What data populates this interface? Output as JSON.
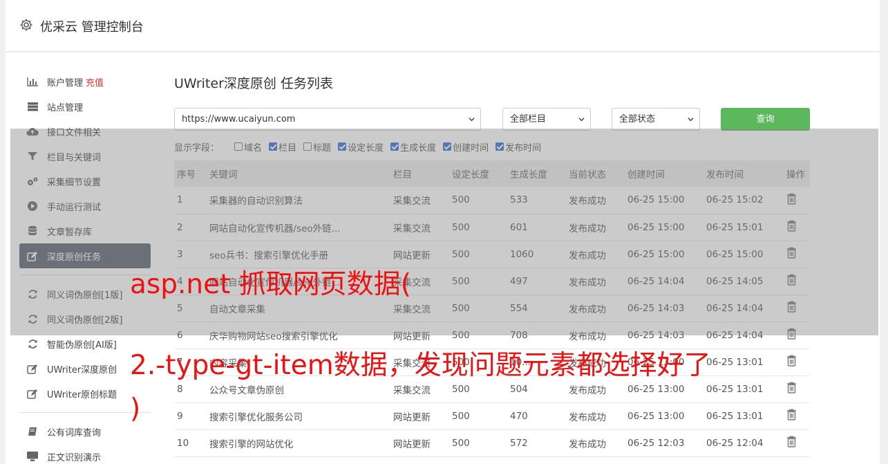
{
  "header": {
    "title": "优采云 管理控制台",
    "icon": "gear-icon"
  },
  "sidebar": {
    "groups": [
      [
        {
          "label": "账户管理",
          "extra": "充值",
          "icon": "bar-chart-icon"
        },
        {
          "label": "站点管理",
          "icon": "server-icon"
        },
        {
          "label": "接口文件相关",
          "icon": "cloud-upload-icon"
        },
        {
          "label": "栏目与关键词",
          "icon": "filter-icon"
        },
        {
          "label": "采集细节设置",
          "icon": "gears-icon"
        },
        {
          "label": "手动运行测试",
          "icon": "play-circle-icon"
        },
        {
          "label": "文章暂存库",
          "icon": "database-icon"
        },
        {
          "label": "深度原创任务",
          "icon": "edit-icon",
          "active": true
        }
      ],
      [
        {
          "label": "同义词伪原创[1版]",
          "icon": "refresh-icon"
        },
        {
          "label": "同义词伪原创[2版]",
          "icon": "refresh-icon"
        },
        {
          "label": "智能伪原创[AI版]",
          "icon": "refresh-icon"
        },
        {
          "label": "UWriter深度原创",
          "icon": "edit-icon"
        },
        {
          "label": "UWriter原创标题",
          "icon": "edit-icon"
        }
      ],
      [
        {
          "label": "公有词库查询",
          "icon": "book-icon"
        },
        {
          "label": "正文识别演示",
          "icon": "monitor-icon"
        }
      ]
    ]
  },
  "main": {
    "title": "UWriter深度原创 任务列表",
    "site_select": "https://www.ucaiyun.com",
    "column_select": "全部栏目",
    "status_select": "全部状态",
    "query_label": "查询",
    "fields_label": "显示字段：",
    "fields": [
      {
        "label": "域名",
        "checked": false
      },
      {
        "label": "栏目",
        "checked": true
      },
      {
        "label": "标题",
        "checked": false
      },
      {
        "label": "设定长度",
        "checked": true
      },
      {
        "label": "生成长度",
        "checked": true
      },
      {
        "label": "创建时间",
        "checked": true
      },
      {
        "label": "发布时间",
        "checked": true
      }
    ],
    "columns": [
      "序号",
      "关键词",
      "栏目",
      "设定长度",
      "生成长度",
      "当前状态",
      "创建时间",
      "发布时间",
      "操作"
    ],
    "rows": [
      [
        "1",
        "采集器的自动识别算法",
        "采集交流",
        "500",
        "533",
        "发布成功",
        "06-25 15:00",
        "06-25 15:02"
      ],
      [
        "2",
        "网站自动化宣传机器/seo外链...",
        "采集交流",
        "500",
        "601",
        "发布成功",
        "06-25 15:00",
        "06-25 15:01"
      ],
      [
        "3",
        "seo兵书：搜索引擎优化手册",
        "网站更新",
        "500",
        "1060",
        "发布成功",
        "06-25 15:00",
        "06-25 15:00"
      ],
      [
        "4",
        "网站自动化宣传机器/seo外链...",
        "采集交流",
        "500",
        "497",
        "发布成功",
        "06-25 14:04",
        "06-25 14:05"
      ],
      [
        "5",
        "自动文章采集",
        "采集交流",
        "500",
        "554",
        "发布成功",
        "06-25 14:03",
        "06-25 14:04"
      ],
      [
        "6",
        "庆华购物网站seo搜索引擎优化",
        "网站更新",
        "500",
        "708",
        "发布成功",
        "06-25 14:03",
        "06-25 14:04"
      ],
      [
        "7",
        "内容采集",
        "采集交流",
        "500",
        "10...",
        "发布成功",
        "06-25 13:00",
        "06-25 13:01"
      ],
      [
        "8",
        "公众号文章伪原创",
        "采集交流",
        "500",
        "504",
        "发布成功",
        "06-25 13:00",
        "06-25 13:01"
      ],
      [
        "9",
        "搜索引擎优化服务公司",
        "网站更新",
        "500",
        "470",
        "发布成功",
        "06-25 13:00",
        "06-25 13:01"
      ],
      [
        "10",
        "搜索引擎的网站优化",
        "网站更新",
        "500",
        "572",
        "发布成功",
        "06-25 12:03",
        "06-25 12:04"
      ]
    ],
    "action_icon": "trash-icon"
  },
  "overlay": {
    "caption_line1": "asp.net 抓取网页数据(",
    "caption_line2": "2.-type-gt-item数据，发现问题元素都选择好了",
    "caption_line3": ")"
  },
  "colors": {
    "accent_green": "#5cb85c",
    "status_green": "#2a9a2a",
    "active_bg": "#5a6170",
    "caption_red": "#ee1111"
  }
}
